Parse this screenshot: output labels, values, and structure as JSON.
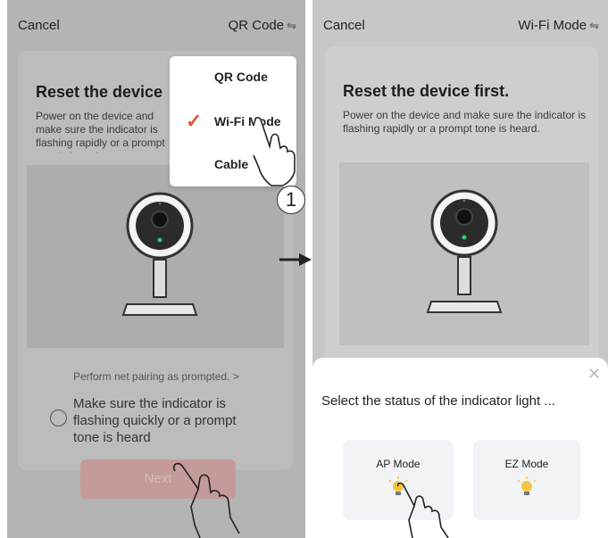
{
  "left": {
    "cancel": "Cancel",
    "mode": "QR Code",
    "title": "Reset the device",
    "desc": "Power on the device and make sure the indicator is flashing rapidly or a prompt tone is heard.",
    "hint": "Perform net pairing as prompted. >",
    "confirm": "Make sure the indicator is flashing quickly or a prompt tone is heard",
    "next": "Next",
    "menu": [
      {
        "label": "QR Code"
      },
      {
        "label": "Wi-Fi Mode"
      },
      {
        "label": "Cable"
      }
    ],
    "step_badge": "1"
  },
  "right": {
    "cancel": "Cancel",
    "mode": "Wi-Fi Mode",
    "title": "Reset the device first.",
    "desc": "Power on the device and make sure the indicator is flashing rapidly or a prompt tone is heard.",
    "sheet": {
      "question": "Select the status of the indicator light ...",
      "options": [
        {
          "label": "AP Mode"
        },
        {
          "label": "EZ Mode"
        }
      ]
    }
  },
  "colors": {
    "check": "#e4572e",
    "next_button": "#c59a9a",
    "led_green": "#2ecc71",
    "bulb": "#f5c542"
  }
}
